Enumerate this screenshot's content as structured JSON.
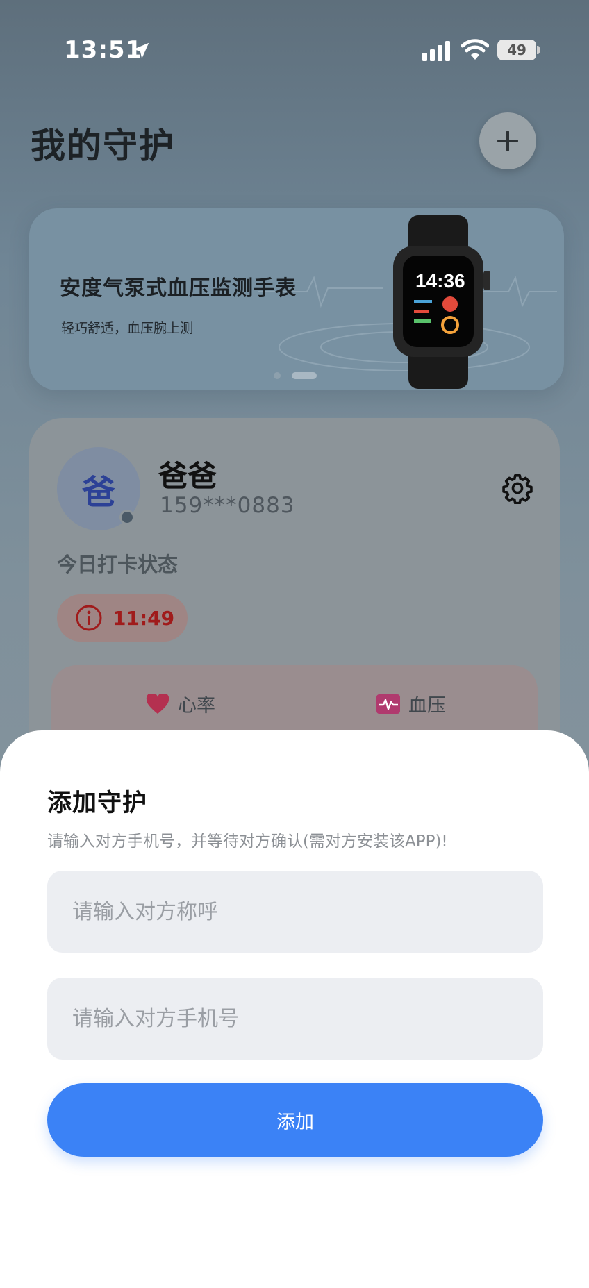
{
  "status_bar": {
    "time": "13:51",
    "battery": "49"
  },
  "header": {
    "title": "我的守护"
  },
  "banner": {
    "title": "安度气泵式血压监测手表",
    "subtitle": "轻巧舒适，血压腕上测",
    "watch_time": "14:36"
  },
  "guardian": {
    "avatar_char": "爸",
    "name": "爸爸",
    "phone": "159***0883",
    "checkin_title": "今日打卡状态",
    "checkin_time": "11:49",
    "metrics": [
      {
        "label": "心率"
      },
      {
        "label": "血压"
      }
    ]
  },
  "sheet": {
    "title": "添加守护",
    "subtitle": "请输入对方手机号，并等待对方确认(需对方安装该APP)!",
    "name_placeholder": "请输入对方称呼",
    "phone_placeholder": "请输入对方手机号",
    "submit_label": "添加"
  },
  "colors": {
    "accent": "#3b82f6",
    "alert": "#a01b1b",
    "heart": "#c2305a"
  }
}
